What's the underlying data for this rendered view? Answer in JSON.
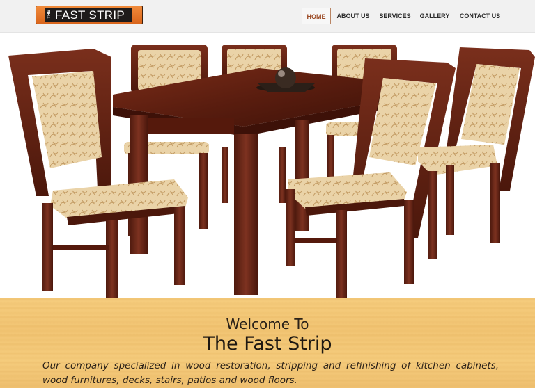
{
  "brand": {
    "logo_prefix": "THE",
    "logo_word": "FAST STRIP"
  },
  "nav": {
    "items": [
      {
        "label": "HOME",
        "active": true
      },
      {
        "label": "ABOUT US",
        "active": false
      },
      {
        "label": "SERVICES",
        "active": false
      },
      {
        "label": "GALLERY",
        "active": false
      },
      {
        "label": "CONTACT US",
        "active": false
      }
    ]
  },
  "colors": {
    "header_bg": "#f1f1f1",
    "nav_active_border": "#b98564",
    "logo_orange": "#e0762a",
    "wood_dark": "#6b2716",
    "upholstery": "#e8cfa4",
    "welcome_bg": "#f4c878"
  },
  "hero": {
    "image": "dining-table-with-chairs"
  },
  "welcome": {
    "title": "Welcome To",
    "heading": "The Fast Strip",
    "description": "Our company specialized in wood restoration, stripping and refinishing of kitchen cabinets, wood furnitures, decks, stairs, patios and wood floors."
  }
}
